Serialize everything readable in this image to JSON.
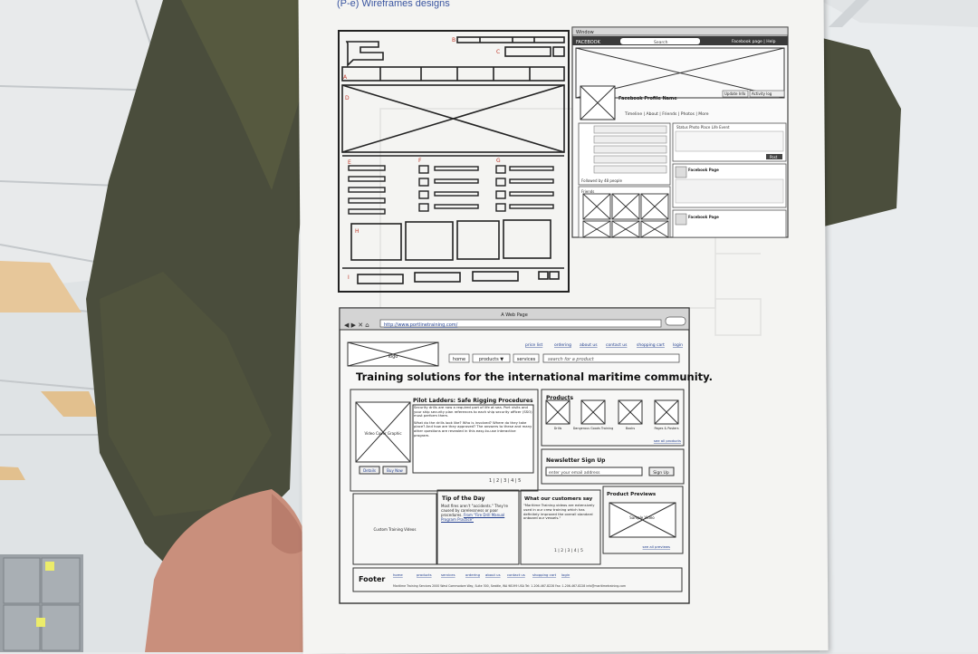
{
  "document": {
    "caption": "(P-e) Wireframes designs"
  },
  "wireframe_top_left": {
    "letters": [
      "A",
      "B",
      "C",
      "D",
      "E",
      "F",
      "G",
      "H",
      "I"
    ]
  },
  "wireframe_facebook": {
    "window_title": "Window",
    "brand": "FACEBOOK",
    "search_placeholder": "Search",
    "top_links": "Facebook page | Help",
    "profile_name": "Facebook Profile Name",
    "update_info": "Update Info",
    "activity_log": "Activity log",
    "tabs": "Timeline | About | Friends | Photos | More",
    "post_tabs": "Status  Photo  Place  Life Event",
    "post_button": "Post",
    "page_name_1": "Facebook Page",
    "page_name_2": "Facebook Page",
    "followed": "Followed by 48 people",
    "friends": "Friends"
  },
  "wireframe_web_page": {
    "window_title": "A Web Page",
    "url": "http://www.portlinetraining.com/",
    "top_links": [
      "price list",
      "ordering",
      "about us",
      "contact us",
      "shopping cart",
      "login"
    ],
    "logo": "logo",
    "nav": [
      "home",
      "products ▼",
      "services"
    ],
    "search_placeholder": "search for a product",
    "headline": "Training solutions for the international maritime community.",
    "feature_title": "Pilot Ladders: Safe Rigging Procedures",
    "feature_text_1": "Security drills are now a required part of life at sea. Port visits and your ship security plan references to each ship security officer (SSO) must perform them.",
    "feature_text_2": "What do the drills look like? Who is involved? Where do they take place? And how are they approved? The answers to these and many other questions are revealed in this easy-to-use interactive program.",
    "video_label": "Video Cover Graphic",
    "details_button": "Details",
    "buy_button": "Buy Now",
    "pager": "1 | 2 | 3 | 4 | 5",
    "products_title": "Products",
    "products": [
      "Drills",
      "Dangerous Goods Training",
      "Books",
      "Pages & Posters"
    ],
    "see_all": "see all products",
    "newsletter_title": "Newsletter Sign Up",
    "email_placeholder": "enter your email address",
    "signup_button": "Sign Up",
    "custom_label": "Custom Training Videos",
    "tip_title": "Tip of the Day",
    "tip_text": "Most fires aren't \"accidents.\" They're caused by carelessness or poor procedures.",
    "tip_link": "From \"Fire Drill Manual Program Practice\"",
    "customers_title": "What our customers say",
    "customers_text": "\"Maritime Training videos are extensively used in our crew training which has definitely improved the overall standard onboard our vessels.\"",
    "previews_title": "Product Previews",
    "sample_video": "Sample Video",
    "see_all_previews": "see all previews",
    "footer_title": "Footer",
    "footer_links": [
      "home",
      "products",
      "services",
      "ordering",
      "about us",
      "contact us",
      "shopping cart",
      "login"
    ],
    "footer_address": "Maritime Training Services  2000 West Commodore Way, Suite 300, Seattle, WA 98199 USA  Tel: 1-206-467-8228  Fax: 1-206-467-8228  info@maritimetraining.com"
  }
}
